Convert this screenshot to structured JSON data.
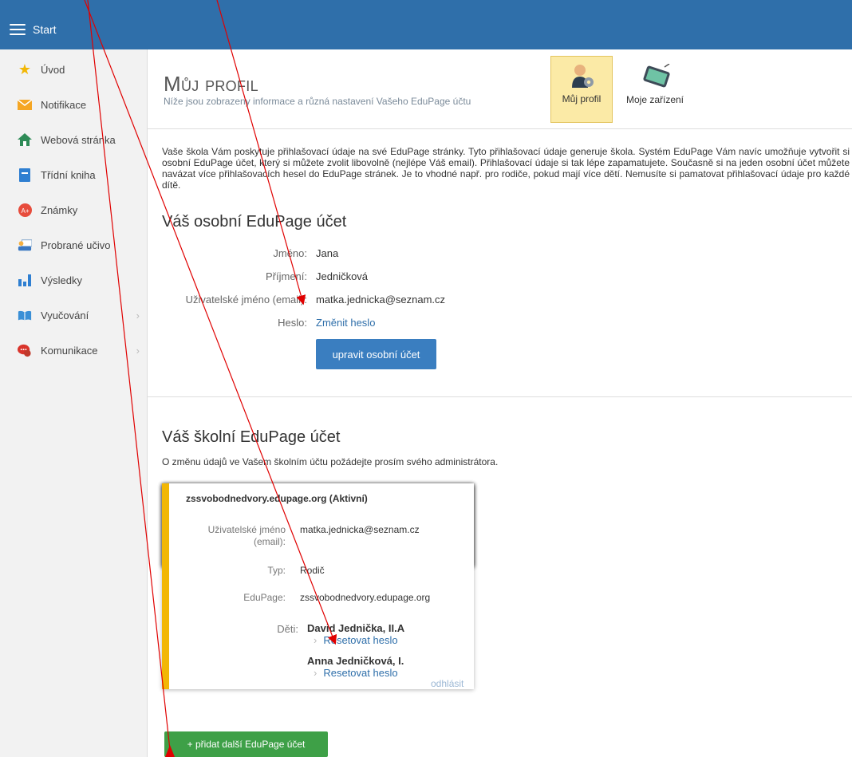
{
  "topbar": {
    "menu_label": "Start"
  },
  "sidebar": {
    "items": [
      {
        "label": "Úvod",
        "icon": "star-icon"
      },
      {
        "label": "Notifikace",
        "icon": "envelope-icon"
      },
      {
        "label": "Webová stránka",
        "icon": "home-icon"
      },
      {
        "label": "Třídní kniha",
        "icon": "book-icon"
      },
      {
        "label": "Známky",
        "icon": "grades-icon"
      },
      {
        "label": "Probrané učivo",
        "icon": "teacher-icon"
      },
      {
        "label": "Výsledky",
        "icon": "bar-chart-icon"
      },
      {
        "label": "Vyučování",
        "icon": "open-book-icon"
      },
      {
        "label": "Komunikace",
        "icon": "chat-icon"
      }
    ]
  },
  "header": {
    "title": "Můj profil",
    "subtitle": "Níže jsou zobrazeny informace a různá nastavení Vašeho EduPage účtu",
    "tabs": [
      {
        "label": "Můj profil"
      },
      {
        "label": "Moje zařízení"
      }
    ]
  },
  "intro": "Vaše škola Vám poskytuje přihlašovací údaje na své EduPage stránky. Tyto přihlašovací údaje generuje škola. Systém EduPage Vám navíc umožňuje vytvořit si osobní EduPage účet, který si můžete zvolit libovolně (nejlépe Váš email). Přihlašovací údaje si tak lépe zapamatujete. Současně si na jeden osobní účet můžete navázat více přihlašovacích hesel do EduPage stránek. Je to vhodné např. pro rodiče, pokud mají více dětí. Nemusíte si pamatovat přihlašovací údaje pro každé dítě.",
  "personal": {
    "heading": "Váš osobní EduPage účet",
    "labels": {
      "first_name": "Jméno:",
      "last_name": "Příjmení:",
      "username": "Uživatelské jméno (email):",
      "password": "Heslo:"
    },
    "values": {
      "first_name": "Jana",
      "last_name": "Jedničková",
      "username": "matka.jednicka@seznam.cz",
      "password_link": "Změnit heslo"
    },
    "edit_button": "upravit osobní účet"
  },
  "school": {
    "heading": "Váš školní EduPage účet",
    "note": "O změnu údajů ve Vašem školním účtu požádejte prosím svého administrátora.",
    "card": {
      "title": "zssvobodnedvory.edupage.org (Aktivní)",
      "labels": {
        "username_1": "Uživatelské jméno",
        "username_2": "(email):",
        "type": "Typ:",
        "edupage": "EduPage:",
        "children": "Děti:"
      },
      "values": {
        "username": "matka.jednicka@seznam.cz",
        "type": "Rodič",
        "edupage": "zssvobodnedvory.edupage.org"
      },
      "children": [
        {
          "name": "David Jednička, II.A",
          "reset": "Resetovat heslo"
        },
        {
          "name": "Anna Jedničková, I.",
          "reset": "Resetovat heslo"
        }
      ],
      "logout": "odhlásit"
    },
    "add_button": "+ přidat další EduPage účet"
  },
  "colors": {
    "topbar": "#2f6faa",
    "accent_stripe": "#f2b705",
    "active_tab": "#fbeaa6",
    "primary_button": "#3a7ec0",
    "add_button": "#3ea047",
    "annotation": "#e00000"
  }
}
